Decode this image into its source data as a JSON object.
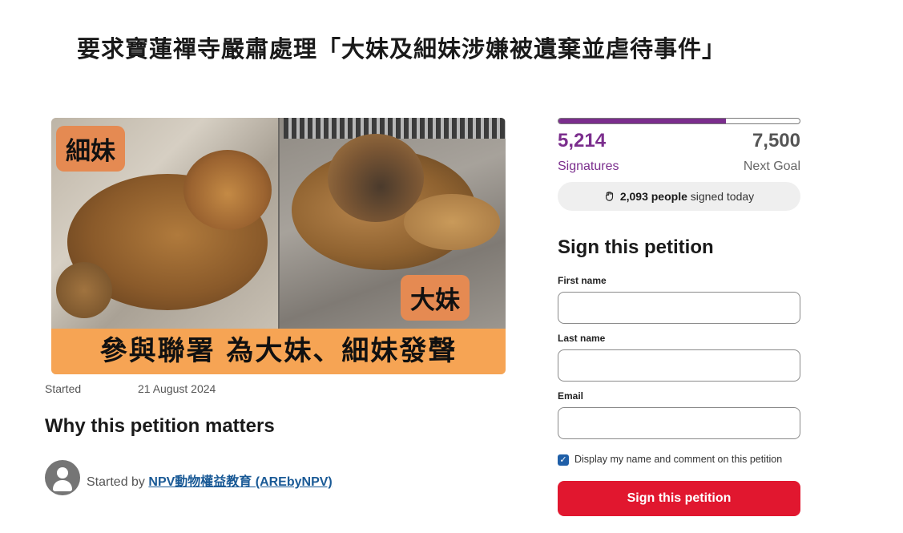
{
  "petition": {
    "title": "要求寶蓮禪寺嚴肅處理「大妹及細妹涉嫌被遺棄並虐待事件」",
    "image": {
      "tag_left": "細妹",
      "tag_right": "大妹",
      "banner": "參與聯署 為大妹、細妹發聲"
    },
    "started_label": "Started",
    "started_date": "21 August 2024",
    "why_heading": "Why this petition matters",
    "started_by_prefix": "Started by",
    "author": "NPV動物權益教育 (AREbyNPV)"
  },
  "progress": {
    "signatures": "5,214",
    "goal": "7,500",
    "fraction": 0.695,
    "signatures_label": "Signatures",
    "goal_label": "Next Goal",
    "today_count": "2,093 people",
    "today_suffix": "signed today",
    "icon": "fist-icon"
  },
  "form": {
    "heading": "Sign this petition",
    "first_name_label": "First name",
    "last_name_label": "Last name",
    "email_label": "Email",
    "first_name_value": "",
    "last_name_value": "",
    "email_value": "",
    "display_checkbox_checked": true,
    "display_checkbox_label": "Display my name and comment on this petition",
    "submit_label": "Sign this petition"
  },
  "colors": {
    "accent_purple": "#7b2e8d",
    "submit_red": "#e1172f",
    "banner_orange": "#f6a454",
    "link_blue": "#1a5a96"
  }
}
